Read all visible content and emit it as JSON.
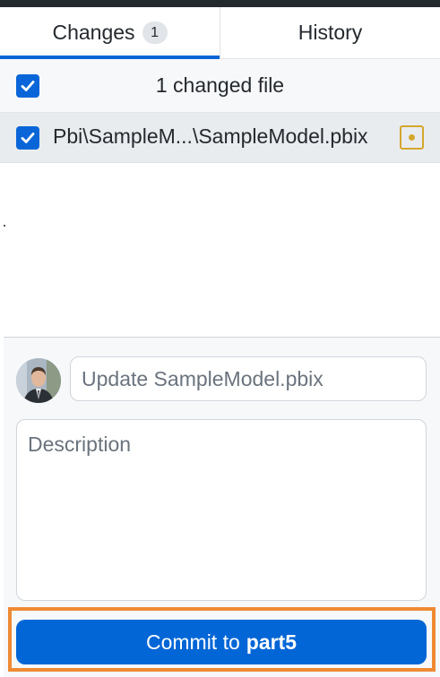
{
  "tabs": {
    "changes": {
      "label": "Changes",
      "count": "1"
    },
    "history": {
      "label": "History"
    }
  },
  "changes_header": {
    "summary": "1 changed file",
    "select_all_checked": true
  },
  "files": [
    {
      "path": "Pbi\\SampleM...\\SampleModel.pbix",
      "checked": true,
      "status": "modified",
      "status_icon": "modified-dot-icon"
    }
  ],
  "commit": {
    "author_avatar": "user-avatar",
    "summary_placeholder": "Update SampleModel.pbix",
    "description_placeholder": "Description",
    "button_prefix": "Commit to",
    "branch": "part5"
  },
  "colors": {
    "accent": "#0366d6",
    "modified": "#d4a72c",
    "highlight": "#ef8a33"
  }
}
